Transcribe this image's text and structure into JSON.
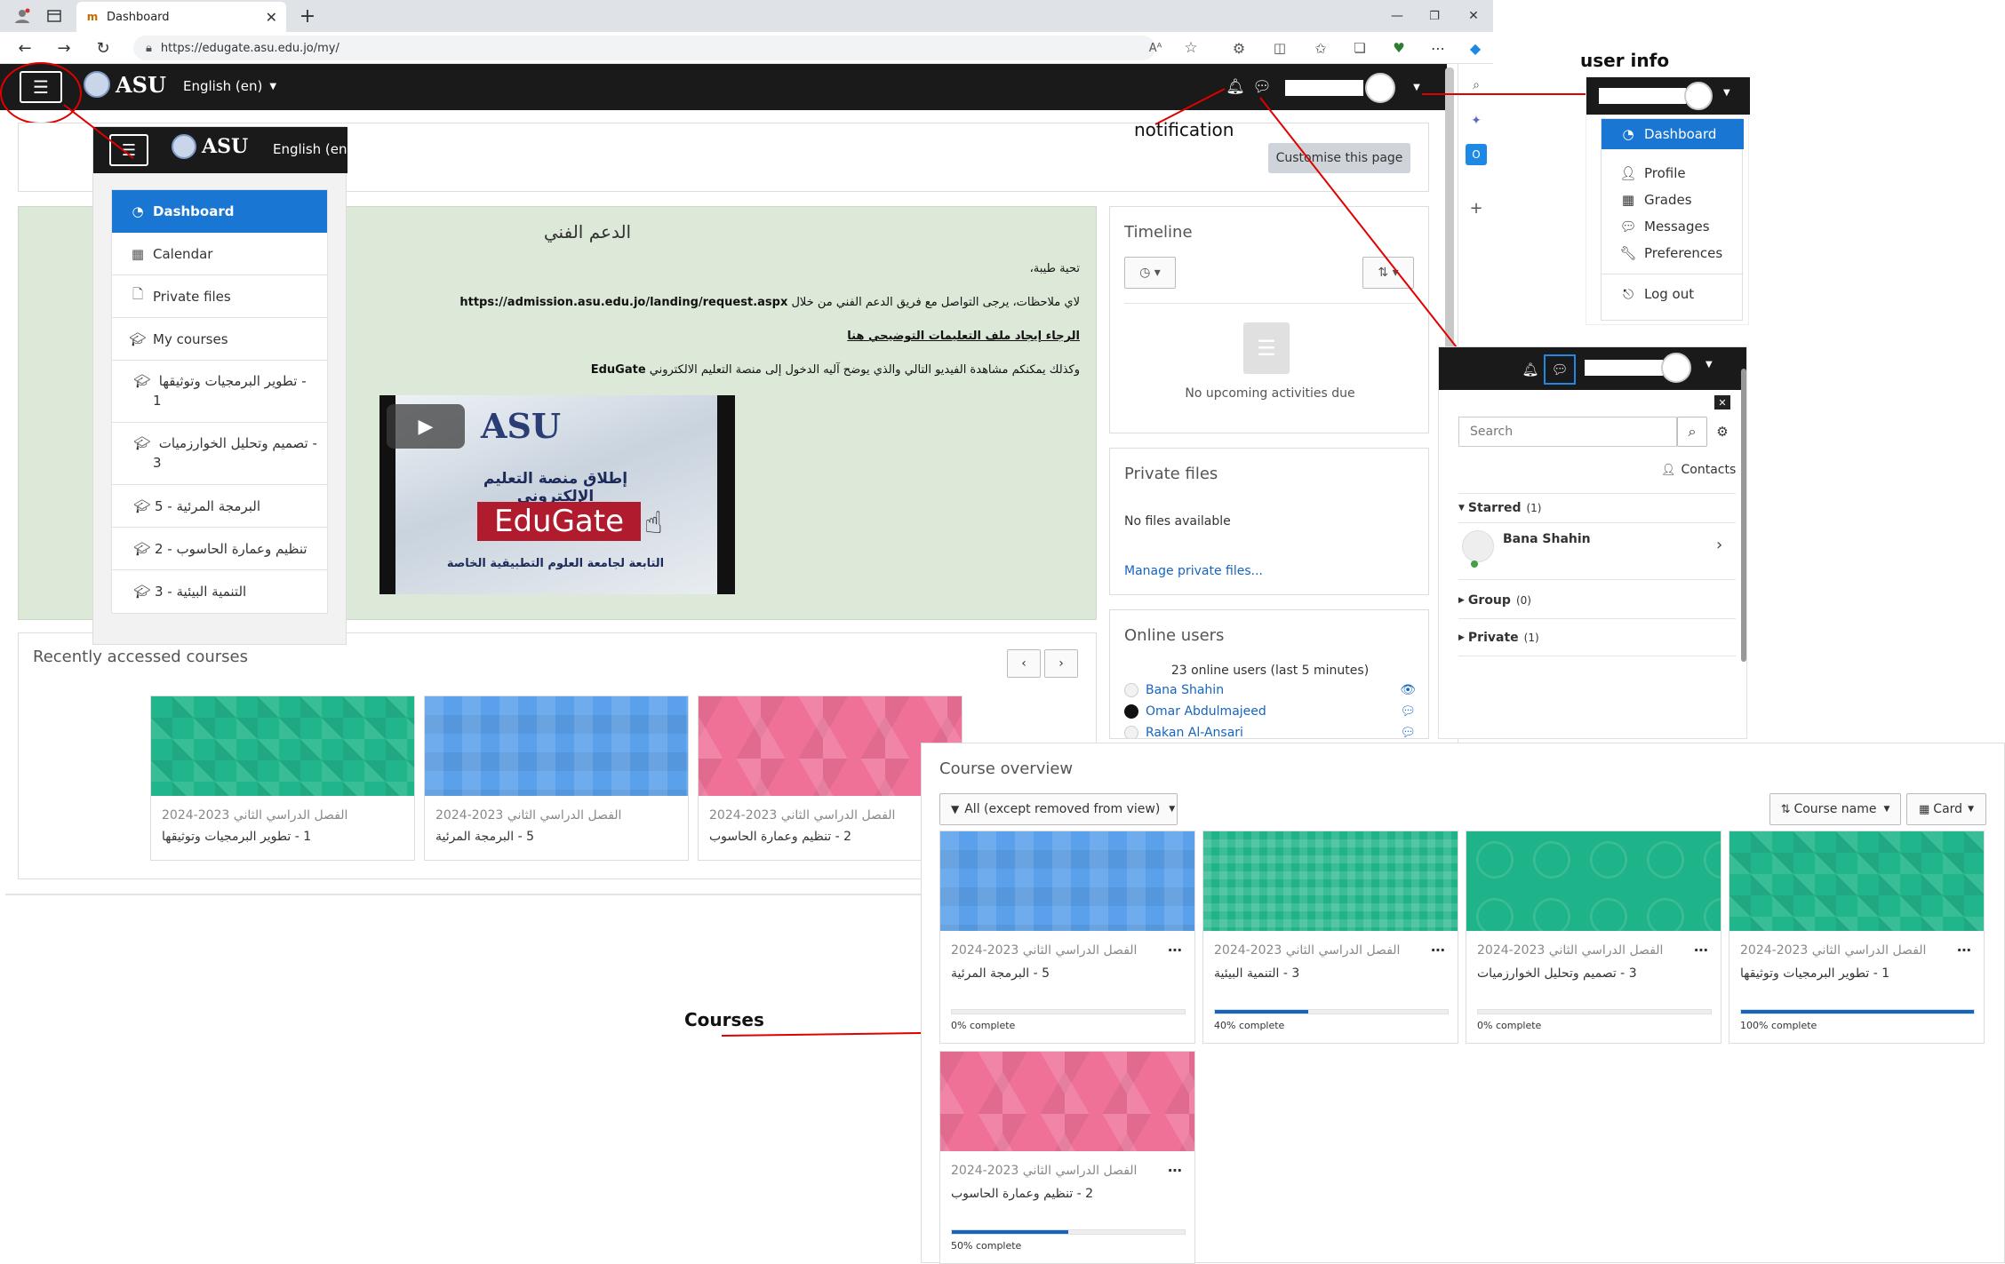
{
  "browser": {
    "tab_title": "Dashboard",
    "url": "https://edugate.asu.edu.jo/my/",
    "reader_label": "Aᴬ"
  },
  "navbar": {
    "logo_text": "ASU",
    "language": "English (en)"
  },
  "annotations": {
    "user_info": "user info",
    "notification": "notification",
    "courses": "Courses"
  },
  "page": {
    "customise_button": "Customise this page"
  },
  "drawer": {
    "logo_text": "ASU",
    "language": "English (en)",
    "items": [
      {
        "label": "Dashboard",
        "icon": "dashboard-icon"
      },
      {
        "label": "Calendar",
        "icon": "calendar-icon"
      },
      {
        "label": "Private files",
        "icon": "file-icon"
      },
      {
        "label": "My courses",
        "icon": "graduation-cap-icon"
      }
    ],
    "courses": [
      {
        "label": "تطوير البرمجيات وتوثيقها -",
        "num": "1"
      },
      {
        "label": "تصميم وتحليل الخوارزميات -",
        "num": "3"
      },
      {
        "label": "5 - البرمجة المرئية",
        "num": ""
      },
      {
        "label": "2 - تنظيم وعمارة الحاسوب",
        "num": ""
      },
      {
        "label": "3 - التنمية البيئية",
        "num": ""
      }
    ]
  },
  "support": {
    "title": "الدعم الفني",
    "greeting": "تحية طيبة،",
    "line1": "لاي ملاحظات، يرجى التواصل مع فريق الدعم الفني من خلال",
    "line1_link": "https://admission.asu.edu.jo/landing/request.aspx",
    "line2": "الرجاء إيجاد ملف التعليمات التوضيحي هنا",
    "line3": "وكذلك يمكنكم مشاهدة الفيديو التالي والذي يوضح آليه الدخول إلى منصة التعليم الالكتروني",
    "line3_brand": "EduGate",
    "video": {
      "logo": "ASU",
      "subtitle": "إطلاق منصة التعليم الإلكتروني",
      "brand": "EduGate",
      "footer": "التابعة لجامعة العلوم التطبيقية الخاصة"
    }
  },
  "timeline": {
    "title": "Timeline",
    "empty": "No upcoming activities due"
  },
  "private_files": {
    "title": "Private files",
    "empty": "No files available",
    "manage": "Manage private files..."
  },
  "online_users": {
    "title": "Online users",
    "count": "23 online users (last 5 minutes)",
    "users": [
      "Bana Shahin",
      "Omar Abdulmajeed",
      "Rakan Al-Ansari"
    ]
  },
  "recent": {
    "title": "Recently accessed courses",
    "cards": [
      {
        "term": "الفصل الدراسي الثاني 2023-2024",
        "name": "1 - تطوير البرمجيات وتوثيقها",
        "pattern": "green"
      },
      {
        "term": "الفصل الدراسي الثاني 2023-2024",
        "name": "5 - البرمجة المرئية",
        "pattern": "blue"
      },
      {
        "term": "الفصل الدراسي الثاني 2023-2024",
        "name": "2 - تنظيم وعمارة الحاسوب",
        "pattern": "pink"
      }
    ]
  },
  "user_menu": {
    "items": [
      "Dashboard",
      "Profile",
      "Grades",
      "Messages",
      "Preferences",
      "Log out"
    ]
  },
  "messages": {
    "search_placeholder": "Search",
    "contacts": "Contacts",
    "starred": "Starred",
    "starred_count": "(1)",
    "contact_name": "Bana Shahin",
    "group": "Group",
    "group_count": "(0)",
    "private": "Private",
    "private_count": "(1)"
  },
  "overview": {
    "title": "Course overview",
    "filter": "All (except removed from view)",
    "sort": "Course name",
    "view": "Card",
    "cards": [
      {
        "term": "الفصل الدراسي الثاني 2023-2024",
        "name": "5 - البرمجة المرئية",
        "progress": 0,
        "progress_label": "0% complete",
        "pattern": "blue"
      },
      {
        "term": "الفصل الدراسي الثاني 2023-2024",
        "name": "3 - التنمية البيئية",
        "progress": 40,
        "progress_label": "40% complete",
        "pattern": "plaid"
      },
      {
        "term": "الفصل الدراسي الثاني 2023-2024",
        "name": "3 - تصميم وتحليل الخوارزميات",
        "progress": 0,
        "progress_label": "0% complete",
        "pattern": "circ"
      },
      {
        "term": "الفصل الدراسي الثاني 2023-2024",
        "name": "1 - تطوير البرمجيات وتوثيقها",
        "progress": 100,
        "progress_label": "100% complete",
        "pattern": "green"
      },
      {
        "term": "الفصل الدراسي الثاني 2023-2024",
        "name": "2 - تنظيم وعمارة الحاسوب",
        "progress": 50,
        "progress_label": "50% complete",
        "pattern": "pink"
      }
    ]
  },
  "colors": {
    "primary": "#1565c0",
    "navbar": "#1a1a1a",
    "annotation": "#e00000",
    "support_bg": "#dce8d8"
  }
}
